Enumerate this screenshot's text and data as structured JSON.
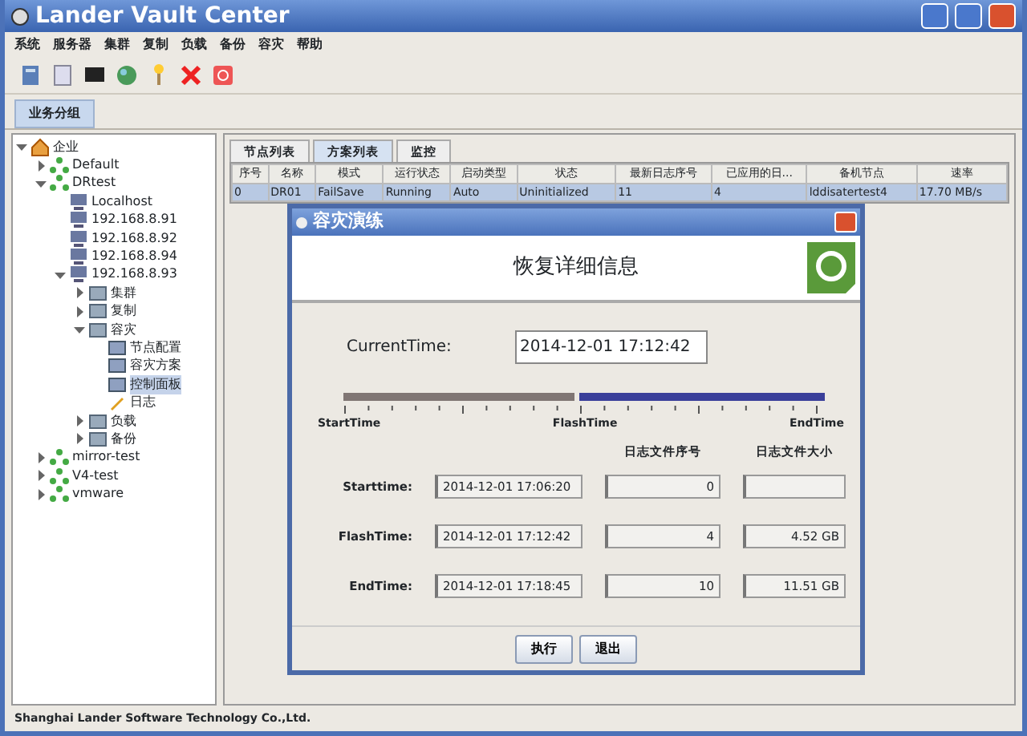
{
  "window": {
    "title": "Lander Vault Center"
  },
  "menu": [
    "系统",
    "服务器",
    "集群",
    "复制",
    "负载",
    "备份",
    "容灾",
    "帮助"
  ],
  "group_tab": {
    "label": "业务分组",
    "selected": true
  },
  "tree": [
    {
      "label": "企业",
      "kind": "root",
      "expanded": true,
      "selected": false,
      "children": [
        {
          "label": "Default",
          "kind": "group",
          "expanded": false,
          "selected": false
        },
        {
          "label": "DRtest",
          "kind": "group",
          "expanded": true,
          "selected": false,
          "children": [
            {
              "label": "Localhost",
              "kind": "host",
              "selected": false
            },
            {
              "label": "192.168.8.91",
              "kind": "host",
              "selected": false
            },
            {
              "label": "192.168.8.92",
              "kind": "host",
              "selected": false
            },
            {
              "label": "192.168.8.94",
              "kind": "host",
              "selected": false
            },
            {
              "label": "192.168.8.93",
              "kind": "host",
              "expanded": true,
              "selected": false,
              "children": [
                {
                  "label": "集群",
                  "kind": "folder",
                  "expanded": false,
                  "selected": false
                },
                {
                  "label": "复制",
                  "kind": "folder",
                  "expanded": false,
                  "selected": false
                },
                {
                  "label": "容灾",
                  "kind": "folder",
                  "expanded": true,
                  "selected": false,
                  "children": [
                    {
                      "label": "节点配置",
                      "kind": "leaf",
                      "selected": false
                    },
                    {
                      "label": "容灾方案",
                      "kind": "leaf",
                      "selected": false
                    },
                    {
                      "label": "控制面板",
                      "kind": "leaf",
                      "selected": true
                    },
                    {
                      "label": "日志",
                      "kind": "log",
                      "selected": false
                    }
                  ]
                },
                {
                  "label": "负载",
                  "kind": "folder",
                  "expanded": false,
                  "selected": false
                },
                {
                  "label": "备份",
                  "kind": "folder",
                  "expanded": false,
                  "selected": false
                }
              ]
            }
          ]
        },
        {
          "label": "mirror-test",
          "kind": "group",
          "expanded": false,
          "selected": false
        },
        {
          "label": "V4-test",
          "kind": "group",
          "expanded": false,
          "selected": false
        },
        {
          "label": "vmware",
          "kind": "group",
          "expanded": false,
          "selected": false
        }
      ]
    }
  ],
  "tabs": [
    {
      "label": "节点列表",
      "selected": false
    },
    {
      "label": "方案列表",
      "selected": true
    },
    {
      "label": "监控",
      "selected": false
    }
  ],
  "table": {
    "columns": [
      "序号",
      "名称",
      "模式",
      "运行状态",
      "启动类型",
      "状态",
      "最新日志序号",
      "已应用的日...",
      "备机节点",
      "速率"
    ],
    "rows": [
      {
        "selected": true,
        "cells": [
          "0",
          "DR01",
          "FailSave",
          "Running",
          "Auto",
          "Uninitialized",
          "11",
          "4",
          "lddisatertest4",
          "17.70 MB/s"
        ]
      }
    ]
  },
  "dialog": {
    "title": "容灾演练",
    "header": "恢复详细信息",
    "current_label": "CurrentTime:",
    "current_value": "2014-12-01 17:12:42",
    "timeline": {
      "level": 0.49,
      "labels": [
        "StartTime",
        "FlashTime",
        "EndTime"
      ]
    },
    "columns": [
      "日志文件序号",
      "日志文件大小"
    ],
    "rows": [
      {
        "label": "Starttime:",
        "time": "2014-12-01 17:06:20",
        "seq": "0"
      },
      {
        "label": "FlashTime:",
        "time": "2014-12-01 17:12:42",
        "seq": "4",
        "size": "4.52 GB"
      },
      {
        "label": "EndTime:",
        "time": "2014-12-01 17:18:45",
        "seq": "10",
        "size": "11.51 GB"
      }
    ],
    "buttons": [
      "执行",
      "退出"
    ]
  },
  "status_bar": "Shanghai Lander Software Technology Co.,Ltd."
}
